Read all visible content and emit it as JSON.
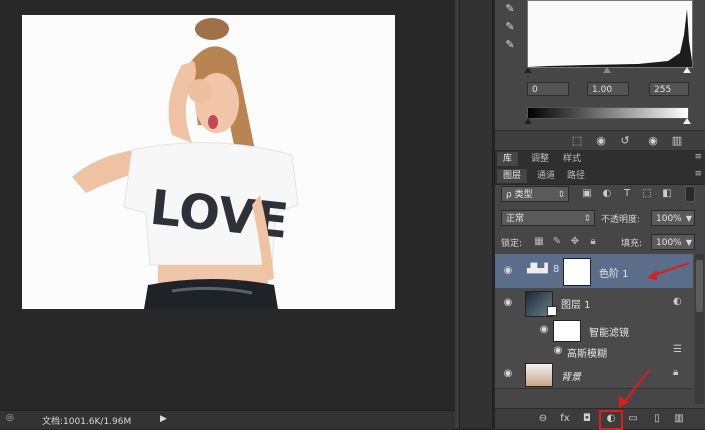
{
  "statusbar": {
    "doc_info": "文档:1001.6K/1.96M",
    "arrow": "▶"
  },
  "levels": {
    "input_values": [
      "0",
      "1.00",
      "255"
    ]
  },
  "panel_tabs_top": [
    {
      "label": "库",
      "active": true
    },
    {
      "label": "调整",
      "active": false
    },
    {
      "label": "样式",
      "active": false
    }
  ],
  "panel_tabs_layers": [
    {
      "label": "图层",
      "active": true
    },
    {
      "label": "通道",
      "active": false
    },
    {
      "label": "路径",
      "active": false
    }
  ],
  "filter": {
    "kind_label": "ρ 类型"
  },
  "blend": {
    "mode": "正常",
    "opacity_label": "不透明度:",
    "opacity_value": "100%"
  },
  "lock": {
    "label": "锁定:",
    "fill_label": "填充:",
    "fill_value": "100%"
  },
  "layers": [
    {
      "name": "色阶 1",
      "selected": true
    },
    {
      "name": "图层 1",
      "selected": false
    },
    {
      "name": "智能滤镜",
      "selected": false
    },
    {
      "name": "高斯模糊",
      "selected": false
    },
    {
      "name": "背景",
      "selected": false
    }
  ],
  "photo": {
    "shirt_text": "LOVE"
  },
  "colors": {
    "selected_layer": "#5a6e8c",
    "annotation_red": "#e01b1b"
  }
}
